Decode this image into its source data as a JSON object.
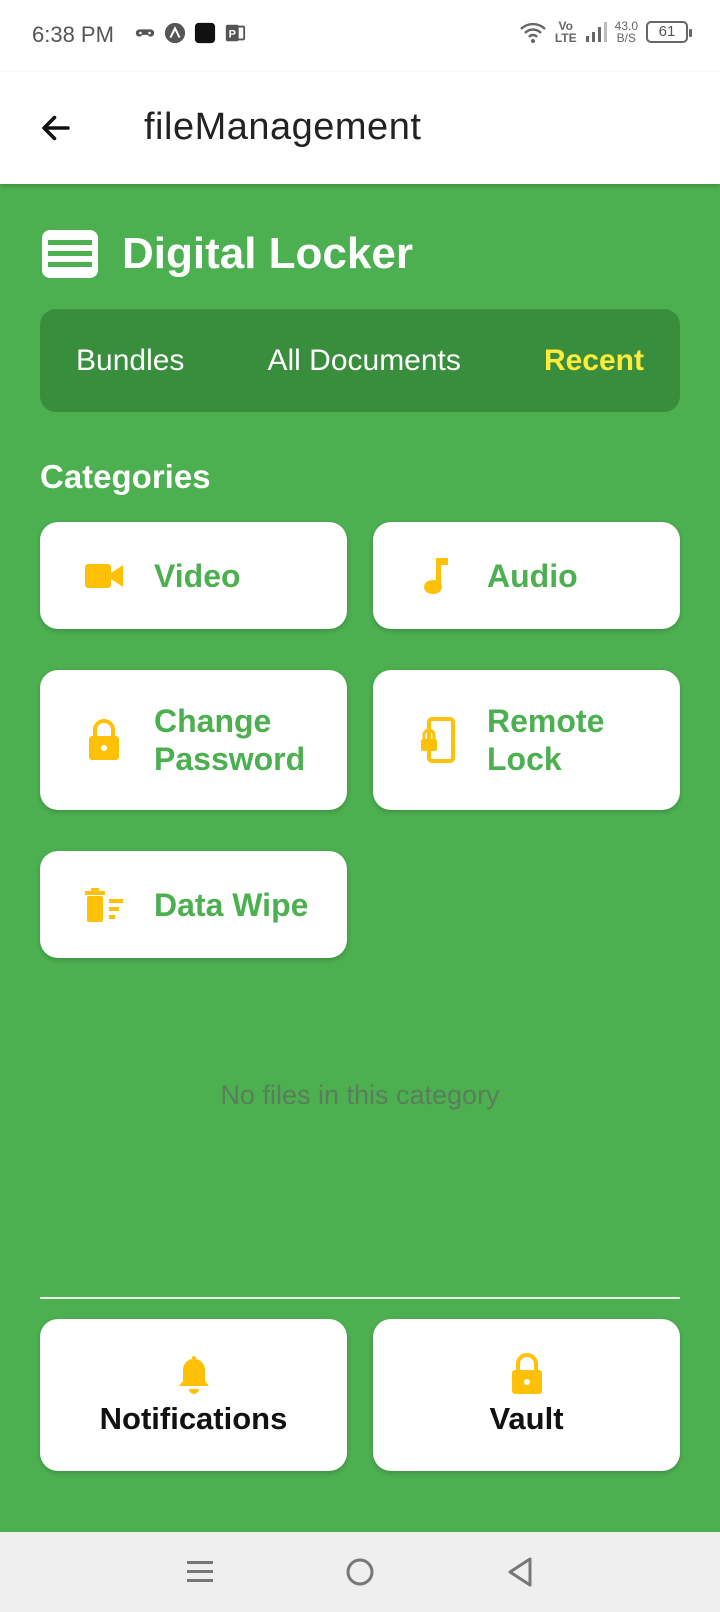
{
  "status_bar": {
    "time": "6:38 PM",
    "network_type_top": "Vo",
    "network_type_bottom": "LTE",
    "speed_value": "43.0",
    "speed_unit": "B/S",
    "battery": "61"
  },
  "app_bar": {
    "title": "fileManagement",
    "back_icon": "arrow-left-icon"
  },
  "header": {
    "icon": "locker-list-icon",
    "title": "Digital Locker"
  },
  "tabs": [
    {
      "label": "Bundles",
      "active": false
    },
    {
      "label": "All Documents",
      "active": false
    },
    {
      "label": "Recent",
      "active": true
    }
  ],
  "categories_title": "Categories",
  "categories": [
    {
      "label": "Video",
      "icon": "videocam-icon"
    },
    {
      "label": "Audio",
      "icon": "music-note-icon"
    },
    {
      "label": "Change Password",
      "icon": "lock-icon"
    },
    {
      "label": "Remote Lock",
      "icon": "phone-lock-icon"
    },
    {
      "label": "Data Wipe",
      "icon": "delete-sweep-icon"
    }
  ],
  "empty_message": "No files in this category",
  "bottom_actions": [
    {
      "label": "Notifications",
      "icon": "bell-icon"
    },
    {
      "label": "Vault",
      "icon": "lock-icon"
    }
  ],
  "colors": {
    "background": "#4CAF50",
    "tab_bar": "#388E3C",
    "accent_yellow": "#FFC107",
    "active_tab": "#FFEB3B",
    "card_text": "#4CAF50"
  }
}
